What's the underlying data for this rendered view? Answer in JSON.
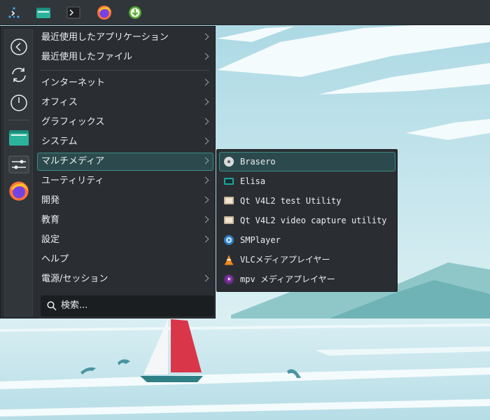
{
  "taskbar": {
    "launcher_icon": "application-launcher-icon",
    "pinned": [
      "file-manager-icon",
      "terminal-icon",
      "firefox-icon",
      "download-icon"
    ]
  },
  "sidebar": {
    "icons": [
      "back-icon",
      "refresh-icon",
      "power-icon",
      "folder-icon",
      "settings-icon",
      "firefox-icon"
    ]
  },
  "menu": {
    "recent": [
      {
        "label": "最近使用したアプリケーション"
      },
      {
        "label": "最近使用したファイル"
      }
    ],
    "categories": [
      {
        "label": "インターネット"
      },
      {
        "label": "オフィス"
      },
      {
        "label": "グラフィックス"
      },
      {
        "label": "システム"
      },
      {
        "label": "マルチメディア"
      },
      {
        "label": "ユーティリティ"
      },
      {
        "label": "開発"
      },
      {
        "label": "教育"
      },
      {
        "label": "設定"
      },
      {
        "label": "ヘルプ"
      },
      {
        "label": "電源/セッション"
      }
    ],
    "search_placeholder": "検索..."
  },
  "submenu": {
    "items": [
      {
        "label": "Brasero",
        "icon": "disc-icon"
      },
      {
        "label": "Elisa",
        "icon": "music-player-icon"
      },
      {
        "label": "Qt V4L2 test Utility",
        "icon": "monitor-icon"
      },
      {
        "label": "Qt V4L2 video capture utility",
        "icon": "monitor-icon"
      },
      {
        "label": "SMPlayer",
        "icon": "smplayer-icon"
      },
      {
        "label": "VLCメディアプレイヤー",
        "icon": "vlc-cone-icon"
      },
      {
        "label": "mpv メディアプレイヤー",
        "icon": "mpv-icon"
      }
    ]
  },
  "colors": {
    "panel": "#31363b",
    "menu_bg": "#2a2e32",
    "highlight_border": "#3d8a85",
    "highlight_bg": "#2c4a4d",
    "sail": "#d9364a"
  }
}
